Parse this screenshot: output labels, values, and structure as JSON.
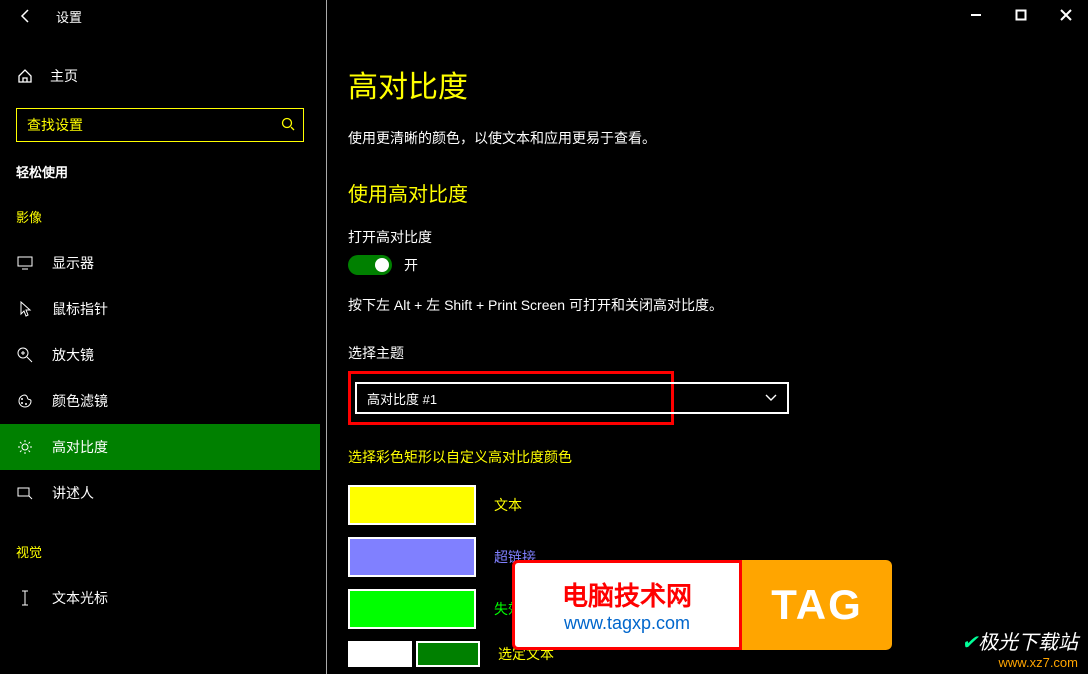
{
  "title": "设置",
  "sidebar": {
    "home": "主页",
    "search_placeholder": "查找设置",
    "section": "轻松使用",
    "groups": [
      {
        "label": "影像",
        "items": [
          {
            "label": "显示器",
            "icon": "monitor"
          },
          {
            "label": "鼠标指针",
            "icon": "cursor"
          },
          {
            "label": "放大镜",
            "icon": "magnifier"
          },
          {
            "label": "颜色滤镜",
            "icon": "palette"
          },
          {
            "label": "高对比度",
            "icon": "brightness",
            "selected": true
          },
          {
            "label": "讲述人",
            "icon": "narrator"
          }
        ]
      },
      {
        "label": "视觉",
        "items": [
          {
            "label": "文本光标",
            "icon": "text-cursor"
          }
        ]
      }
    ]
  },
  "content": {
    "title": "高对比度",
    "subtitle": "使用更清晰的颜色，以使文本和应用更易于查看。",
    "section1": "使用高对比度",
    "toggle_label": "打开高对比度",
    "toggle_state": "开",
    "hint": "按下左 Alt + 左 Shift + Print Screen 可打开和关闭高对比度。",
    "theme_label": "选择主题",
    "theme_value": "高对比度 #1",
    "custom_label": "选择彩色矩形以自定义高对比度颜色",
    "colors": [
      {
        "color": "#ffff00",
        "label": "文本",
        "label_color": "#ffff00"
      },
      {
        "color": "#8080ff",
        "label": "超链接",
        "label_color": "#8080ff"
      },
      {
        "color": "#00ff00",
        "label": "失效文本",
        "label_color": "#00ff00"
      }
    ],
    "selected_label": "选定文本",
    "pair": [
      "#ffffff",
      "#008000"
    ]
  },
  "watermark": {
    "line1": "电脑技术网",
    "line2": "www.tagxp.com",
    "tag": "TAG"
  },
  "corner": {
    "line1": "极光下载站",
    "line2": "www.xz7.com"
  }
}
